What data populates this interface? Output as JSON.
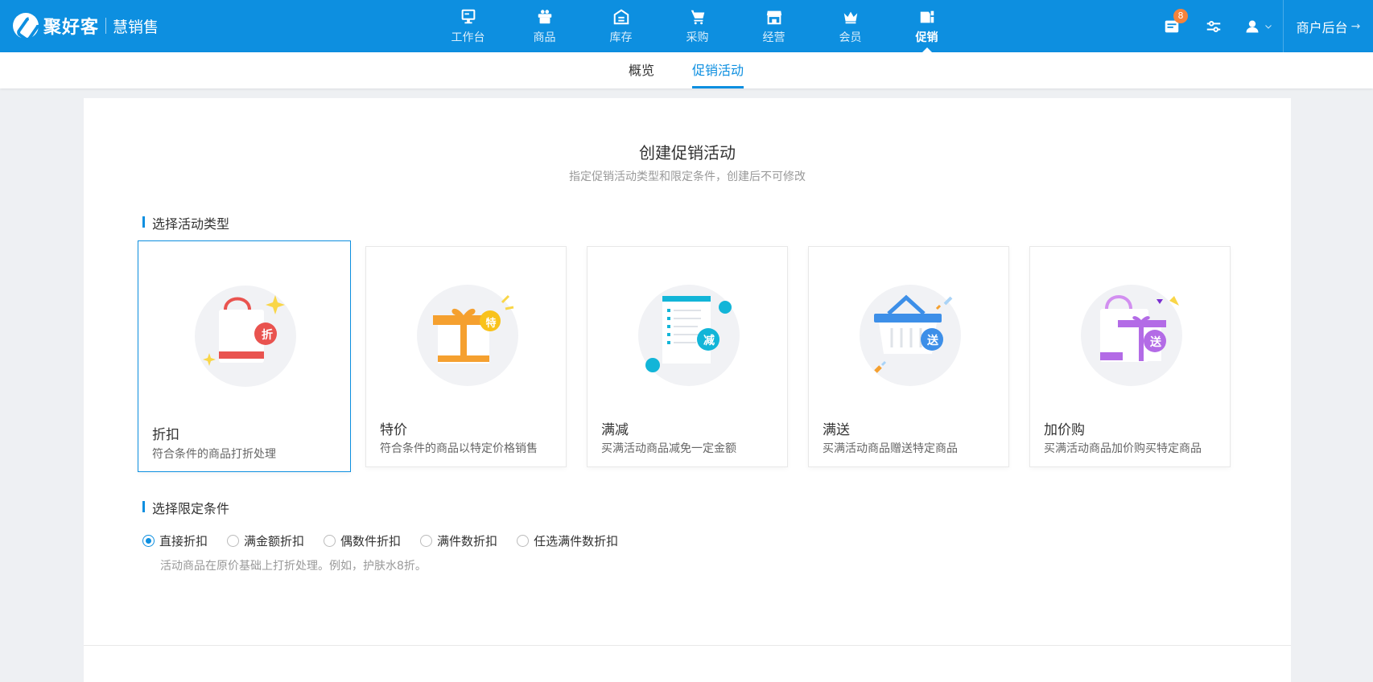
{
  "brand": {
    "name": "聚好客",
    "product": "慧销售"
  },
  "nav": [
    {
      "label": "工作台",
      "icon": "dashboard-icon"
    },
    {
      "label": "商品",
      "icon": "goods-icon"
    },
    {
      "label": "库存",
      "icon": "warehouse-icon"
    },
    {
      "label": "采购",
      "icon": "cart-icon"
    },
    {
      "label": "经营",
      "icon": "store-icon"
    },
    {
      "label": "会员",
      "icon": "crown-icon"
    },
    {
      "label": "促销",
      "icon": "coupon-icon",
      "active": true
    }
  ],
  "tools": {
    "messages_badge": "8",
    "merchant_label": "商户后台",
    "merchant_arrow": "→"
  },
  "subnav": {
    "tabs": [
      {
        "label": "概览"
      },
      {
        "label": "促销活动",
        "active": true
      }
    ]
  },
  "page": {
    "title": "创建促销活动",
    "subtitle": "指定促销活动类型和限定条件，创建后不可修改",
    "section_type": "选择活动类型",
    "section_condition": "选择限定条件",
    "types": [
      {
        "name": "折扣",
        "desc": "符合条件的商品打折处理",
        "badge": "折",
        "selected": true
      },
      {
        "name": "特价",
        "desc": "符合条件的商品以特定价格销售",
        "badge": "特"
      },
      {
        "name": "满减",
        "desc": "买满活动商品减免一定金额",
        "badge": "减"
      },
      {
        "name": "满送",
        "desc": "买满活动商品赠送特定商品",
        "badge": "送"
      },
      {
        "name": "加价购",
        "desc": "买满活动商品加价购买特定商品",
        "badge": "送"
      }
    ],
    "conditions": [
      {
        "label": "直接折扣",
        "checked": true
      },
      {
        "label": "满金额折扣"
      },
      {
        "label": "偶数件折扣"
      },
      {
        "label": "满件数折扣"
      },
      {
        "label": "任选满件数折扣"
      }
    ],
    "hint": "活动商品在原价基础上打折处理。例如，护肤水8折。"
  },
  "colors": {
    "primary": "#0d8fe0",
    "badge": "#f5833b",
    "red": "#e9534f",
    "orange": "#f5a02f",
    "cyan": "#12b5d8",
    "blue": "#3d8fe8",
    "purple": "#b36be6"
  }
}
